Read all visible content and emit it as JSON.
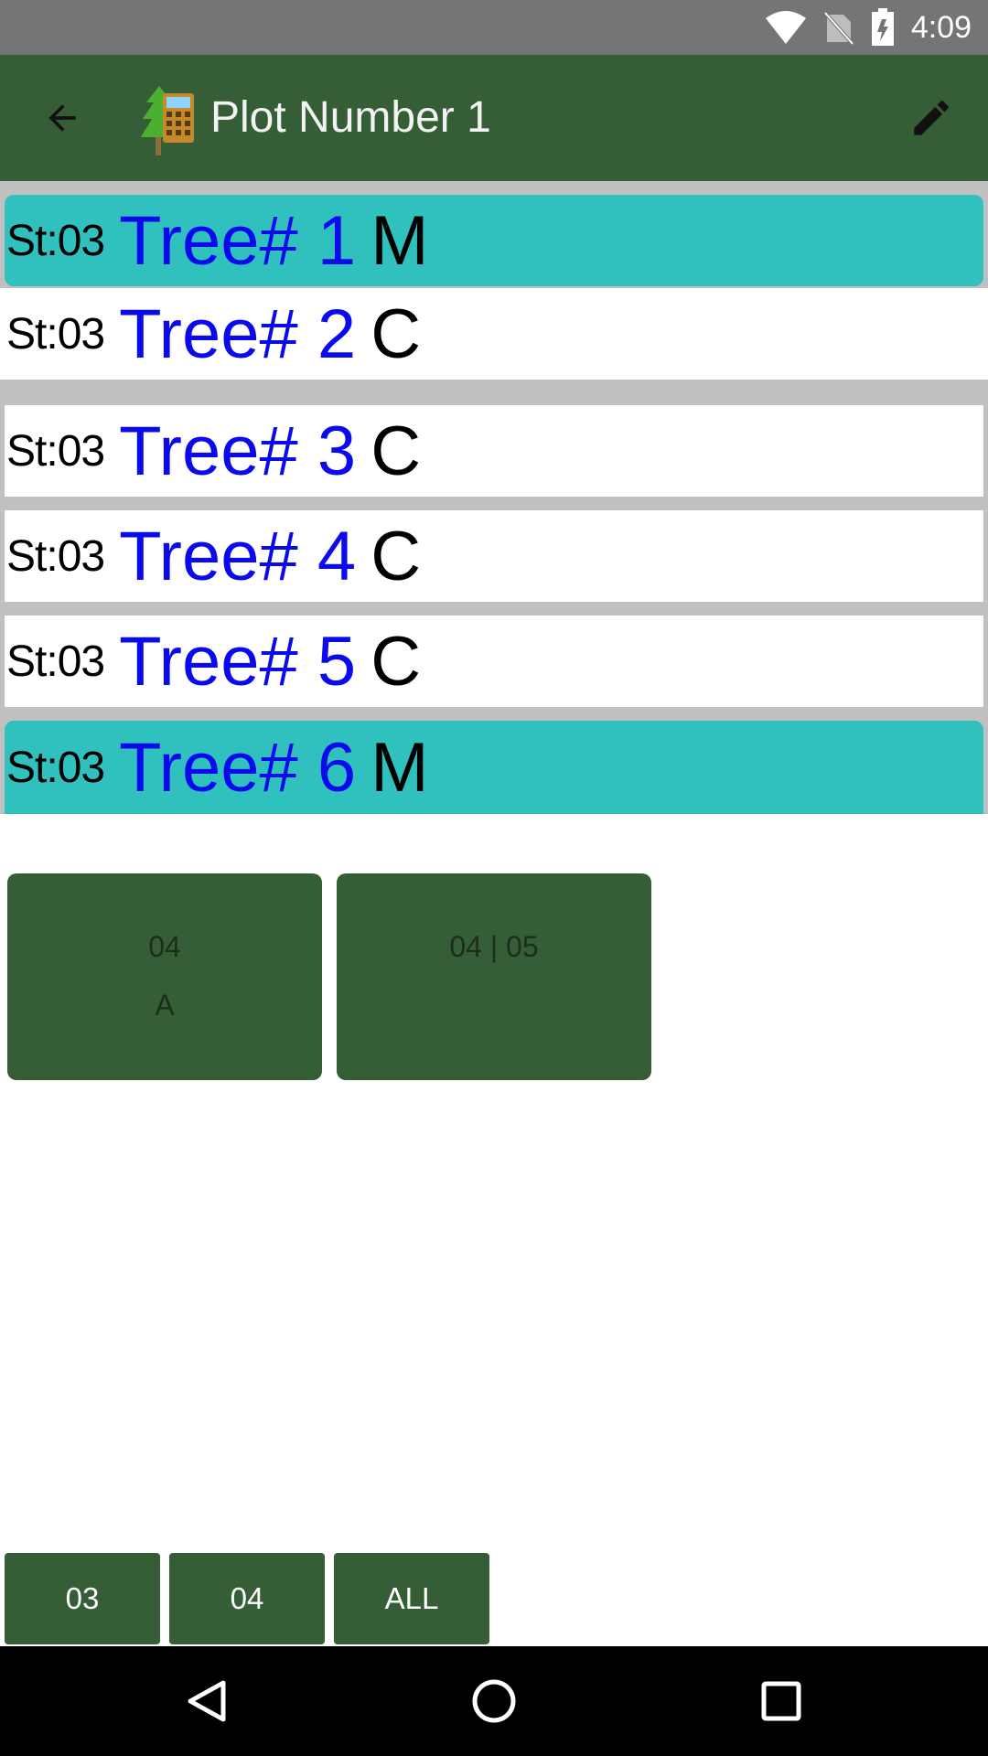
{
  "status_bar": {
    "time": "4:09"
  },
  "app_bar": {
    "title": "Plot Number 1"
  },
  "trees": [
    {
      "st": "St:03",
      "label": "Tree# 1",
      "type": "M"
    },
    {
      "st": "St:03",
      "label": "Tree# 2",
      "type": "C"
    },
    {
      "st": "St:03",
      "label": "Tree# 3",
      "type": "C"
    },
    {
      "st": "St:03",
      "label": "Tree# 4",
      "type": "C"
    },
    {
      "st": "St:03",
      "label": "Tree# 5",
      "type": "C"
    },
    {
      "st": "St:03",
      "label": "Tree# 6",
      "type": "M"
    }
  ],
  "cards": [
    {
      "line1": "04",
      "line2": "A"
    },
    {
      "line1": "04 | 05",
      "line2": ""
    }
  ],
  "filters": [
    "03",
    "04",
    "ALL"
  ],
  "colors": {
    "app_bar": "#365E36",
    "highlight": "#30C1BE",
    "tree_number": "#0a0aec",
    "status_bar": "#757575"
  },
  "icons": {
    "status": [
      "wifi-icon",
      "no-sim-icon",
      "battery-icon"
    ],
    "app_bar": [
      "back-arrow-icon",
      "tree-calculator-logo-icon",
      "pencil-edit-icon"
    ],
    "nav": [
      "nav-back-icon",
      "nav-home-icon",
      "nav-recents-icon"
    ]
  }
}
